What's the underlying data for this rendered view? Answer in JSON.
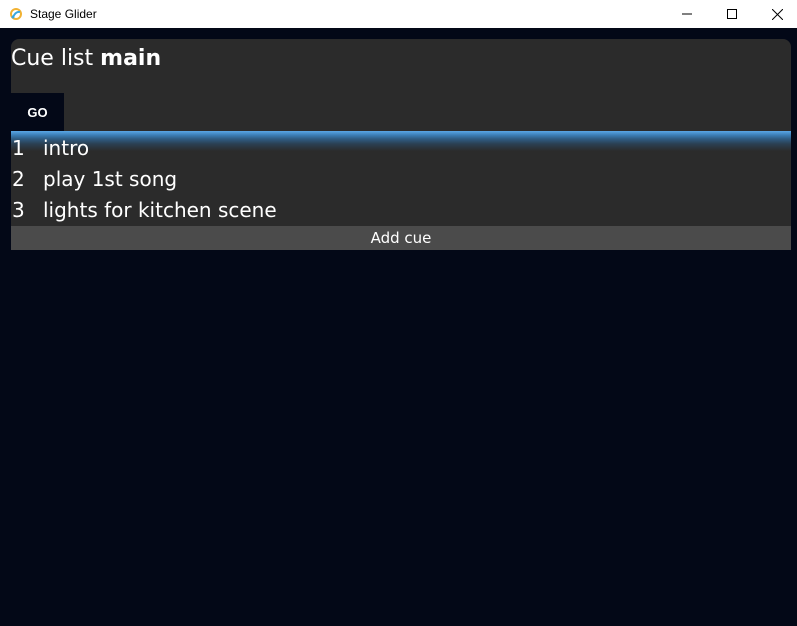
{
  "window": {
    "title": "Stage Glider",
    "icon": "stage-glider-logo-icon",
    "controls": [
      "minimize-icon",
      "maximize-icon",
      "close-icon"
    ]
  },
  "cue_list": {
    "prefix": "Cue list ",
    "name": "main",
    "go_label": "GO",
    "cues": [
      {
        "number": "1",
        "label": "intro",
        "active": true
      },
      {
        "number": "2",
        "label": "play 1st song",
        "active": false
      },
      {
        "number": "3",
        "label": "lights for kitchen scene",
        "active": false
      }
    ],
    "add_label": "Add cue"
  },
  "colors": {
    "background": "#030817",
    "panel": "#2b2b2b",
    "add_button": "#4b4b4b",
    "accent": "#5aa7e6"
  }
}
